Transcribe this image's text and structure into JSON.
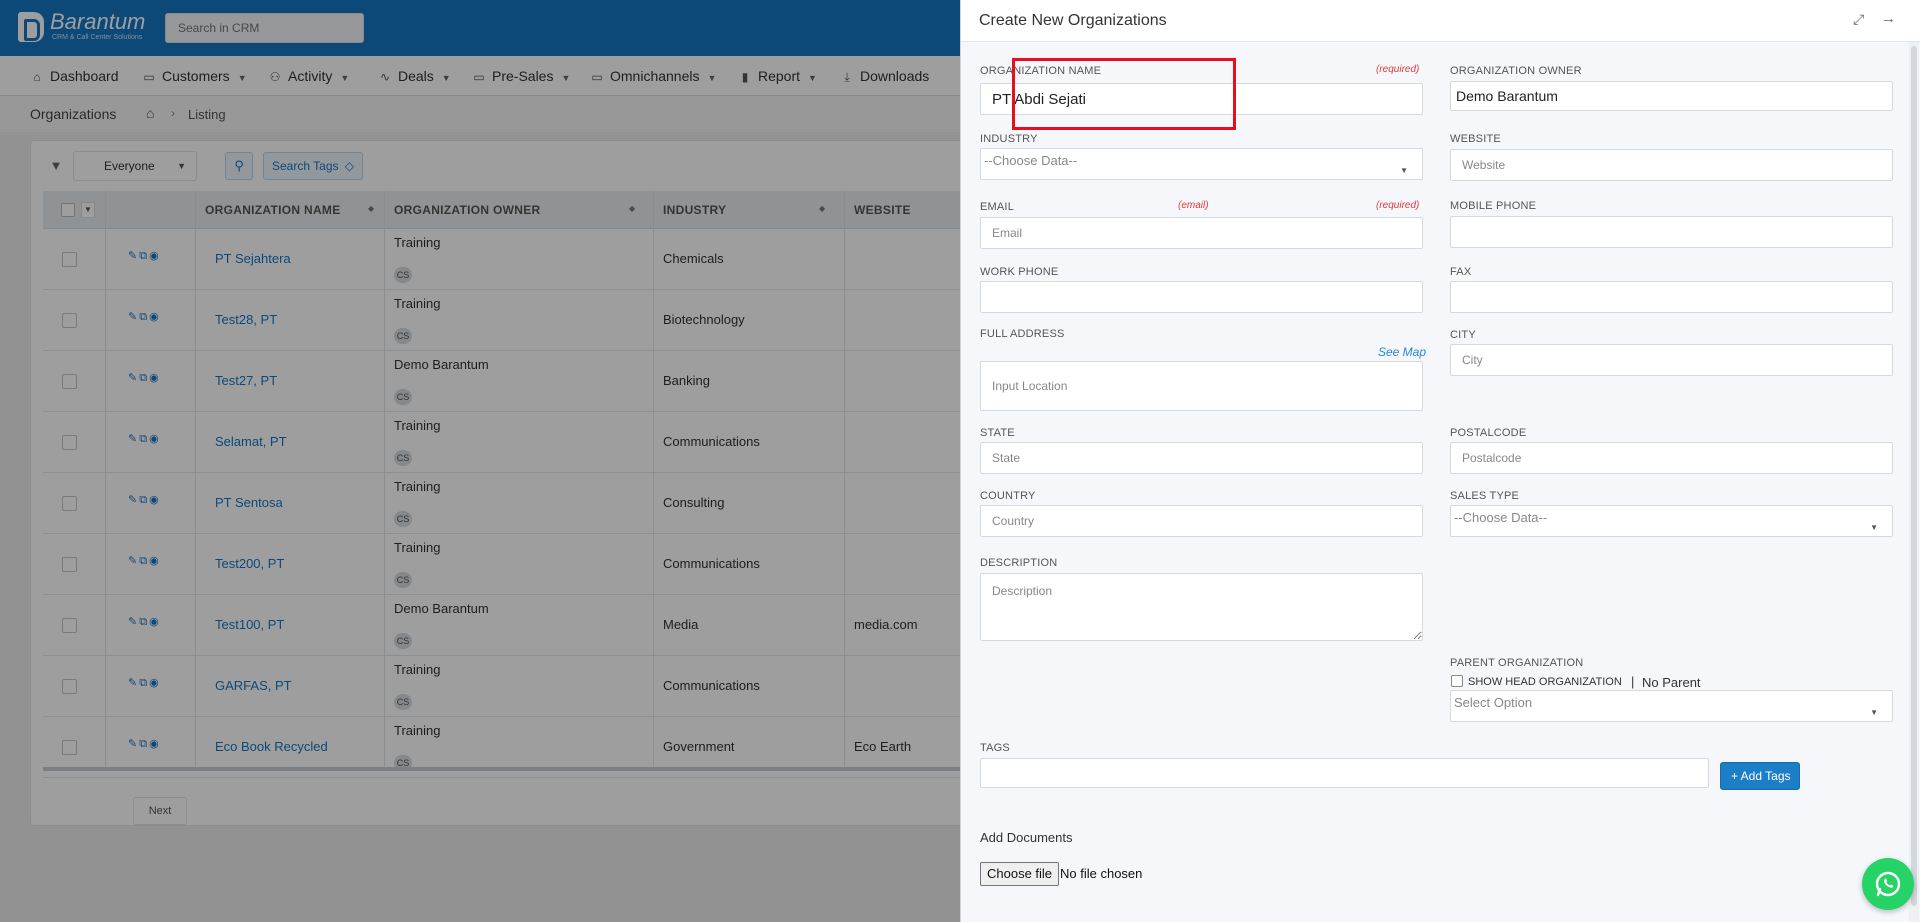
{
  "app": {
    "logo_text": "Barantum",
    "logo_sub": "CRM & Call Center Solutions",
    "search_placeholder": "Search in CRM"
  },
  "nav": [
    {
      "label": "Dashboard",
      "icon": "home-icon"
    },
    {
      "label": "Customers",
      "icon": "folder-icon"
    },
    {
      "label": "Activity",
      "icon": "users-icon"
    },
    {
      "label": "Deals",
      "icon": "pulse-icon"
    },
    {
      "label": "Pre-Sales",
      "icon": "folder-icon"
    },
    {
      "label": "Omnichannels",
      "icon": "folder-icon"
    },
    {
      "label": "Report",
      "icon": "bar-chart-icon"
    },
    {
      "label": "Downloads",
      "icon": "download-icon"
    }
  ],
  "breadcrumb": {
    "title": "Organizations",
    "current": "Listing"
  },
  "filter": {
    "scope": "Everyone",
    "search_tags": "Search Tags"
  },
  "table": {
    "headers": [
      "ORGANIZATION NAME",
      "ORGANIZATION OWNER",
      "INDUSTRY",
      "WEBSITE"
    ],
    "rows": [
      {
        "name": "PT Sejahtera",
        "owner": "Training",
        "badge": "CS",
        "industry": "Chemicals",
        "website": ""
      },
      {
        "name": "Test28, PT",
        "owner": "Training",
        "badge": "CS",
        "industry": "Biotechnology",
        "website": ""
      },
      {
        "name": "Test27, PT",
        "owner": "Demo Barantum",
        "badge": "CS",
        "industry": "Banking",
        "website": ""
      },
      {
        "name": "Selamat, PT",
        "owner": "Training",
        "badge": "CS",
        "industry": "Communications",
        "website": ""
      },
      {
        "name": "PT Sentosa",
        "owner": "Training",
        "badge": "CS",
        "industry": "Consulting",
        "website": ""
      },
      {
        "name": "Test200, PT",
        "owner": "Training",
        "badge": "CS",
        "industry": "Communications",
        "website": ""
      },
      {
        "name": "Test100, PT",
        "owner": "Demo Barantum",
        "badge": "CS",
        "industry": "Media",
        "website": "media.com"
      },
      {
        "name": "GARFAS, PT",
        "owner": "Training",
        "badge": "CS",
        "industry": "Communications",
        "website": ""
      },
      {
        "name": "Eco Book Recycled",
        "owner": "Training",
        "badge": "CS",
        "industry": "Government",
        "website": "Eco Earth"
      }
    ],
    "next_label": "Next"
  },
  "panel": {
    "title": "Create New Organizations",
    "required_tag": "(required)",
    "email_tag": "(email)",
    "see_map": "See Map",
    "fields": {
      "org_name": {
        "label": "ORGANIZATION NAME",
        "value": "PT Abdi Sejati"
      },
      "org_owner": {
        "label": "ORGANIZATION OWNER",
        "value": "Demo Barantum"
      },
      "industry": {
        "label": "INDUSTRY",
        "value": "--Choose Data--"
      },
      "website": {
        "label": "WEBSITE",
        "placeholder": "Website"
      },
      "email": {
        "label": "EMAIL",
        "placeholder": "Email"
      },
      "mobile": {
        "label": "MOBILE PHONE",
        "placeholder": ""
      },
      "work_phone": {
        "label": "WORK PHONE",
        "placeholder": ""
      },
      "fax": {
        "label": "FAX",
        "placeholder": ""
      },
      "address": {
        "label": "FULL ADDRESS",
        "placeholder": "Input Location"
      },
      "city": {
        "label": "CITY",
        "placeholder": "City"
      },
      "state": {
        "label": "STATE",
        "placeholder": "State"
      },
      "postal": {
        "label": "POSTALCODE",
        "placeholder": "Postalcode"
      },
      "country": {
        "label": "COUNTRY",
        "placeholder": "Country"
      },
      "sales_type": {
        "label": "SALES TYPE",
        "value": "--Choose Data--"
      },
      "description": {
        "label": "DESCRIPTION",
        "placeholder": "Description"
      },
      "parent": {
        "label": "PARENT ORGANIZATION",
        "show_head": "SHOW HEAD ORGANIZATION",
        "sep": "|",
        "no_parent": "No Parent",
        "select_placeholder": "Select Option"
      },
      "tags": {
        "label": "TAGS",
        "add_button": "+ Add Tags"
      },
      "docs": {
        "label": "Add Documents",
        "choose": "Choose file",
        "no_file": "No file chosen"
      }
    }
  },
  "colors": {
    "brand": "#1576c2",
    "required": "#e03a3a",
    "highlight": "#e4101e",
    "whatsapp": "#25d366"
  }
}
